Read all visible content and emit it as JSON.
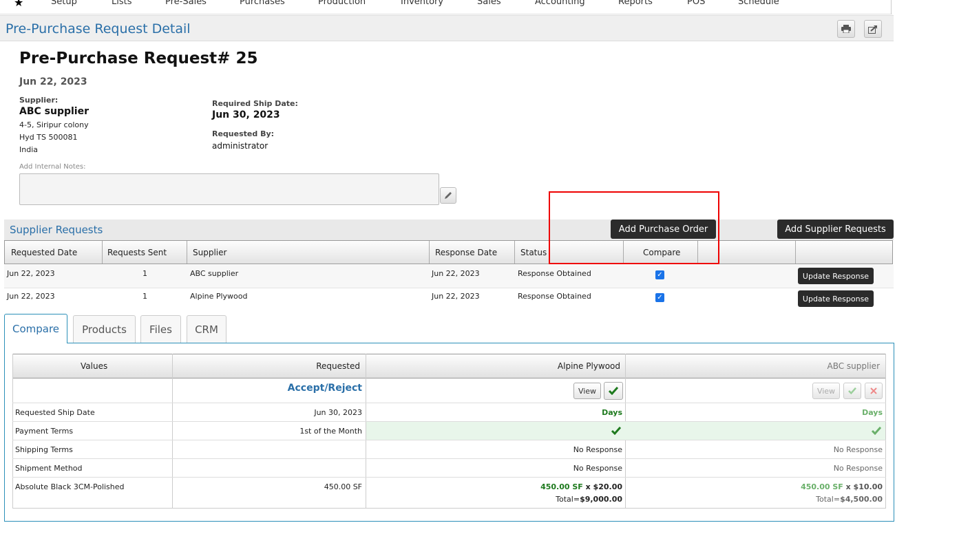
{
  "nav": {
    "items": [
      "Setup",
      "Lists",
      "Pre-Sales",
      "Purchases",
      "Production",
      "Inventory",
      "Sales",
      "Accounting",
      "Reports",
      "POS",
      "Schedule"
    ]
  },
  "page": {
    "title": "Pre-Purchase Request Detail",
    "print_icon": "printer-icon",
    "share_icon": "share-icon"
  },
  "request": {
    "heading": "Pre-Purchase Request# 25",
    "date": "Jun 22, 2023",
    "supplier_label": "Supplier:",
    "supplier_name": "ABC supplier",
    "address1": "4-5, Siripur colony",
    "address2": "Hyd TS 500081",
    "address3": "India",
    "ship_date_label": "Required Ship Date:",
    "ship_date": "Jun 30, 2023",
    "requested_by_label": "Requested By:",
    "requested_by": "administrator",
    "notes_label": "Add Internal Notes:",
    "notes_value": ""
  },
  "supplier_requests": {
    "title": "Supplier Requests",
    "add_po_label": "Add Purchase Order",
    "add_sr_label": "Add Supplier Requests",
    "columns": [
      "Requested Date",
      "Requests Sent",
      "Supplier",
      "Response Date",
      "Status",
      "Compare"
    ],
    "rows": [
      {
        "requested_date": "Jun 22, 2023",
        "sent": "1",
        "supplier": "ABC supplier",
        "response_date": "Jun 22, 2023",
        "status": "Response Obtained",
        "action": "Update Response"
      },
      {
        "requested_date": "Jun 22, 2023",
        "sent": "1",
        "supplier": "Alpine Plywood",
        "response_date": "Jun 22, 2023",
        "status": "Response Obtained",
        "action": "Update Response"
      }
    ]
  },
  "tabs": [
    "Compare",
    "Products",
    "Files",
    "CRM"
  ],
  "compare": {
    "headers": [
      "Values",
      "Requested",
      "Alpine Plywood",
      "ABC supplier"
    ],
    "accept_reject": "Accept/Reject",
    "view_label": "View",
    "rows": [
      {
        "label": "Requested Ship Date",
        "requested": "Jun 30, 2023",
        "alpine": "Days",
        "abc": "Days"
      },
      {
        "label": "Payment Terms",
        "requested": "1st of the Month",
        "alpine": "",
        "abc": ""
      },
      {
        "label": "Shipping Terms",
        "requested": "",
        "alpine": "No Response",
        "abc": "No Response"
      },
      {
        "label": "Shipment Method",
        "requested": "",
        "alpine": "No Response",
        "abc": "No Response"
      },
      {
        "label": "Absolute Black 3CM-Polished",
        "requested": "450.00 SF"
      }
    ],
    "alpine_qty": "450.00 SF",
    "alpine_price": "x $20.00",
    "alpine_total_label": "Total=",
    "alpine_total": "$9,000.00",
    "abc_qty": "450.00 SF",
    "abc_price": "x $10.00",
    "abc_total_label": "Total=",
    "abc_total": "$4,500.00"
  }
}
